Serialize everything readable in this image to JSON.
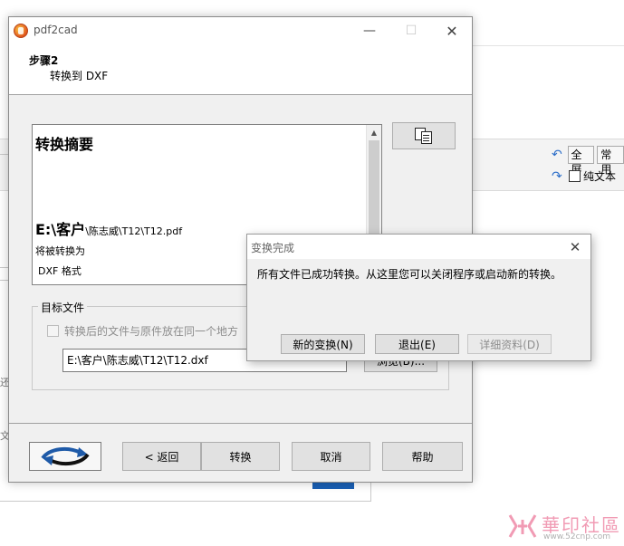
{
  "background": {
    "toolbar": {
      "fullscreen_label": "全屏",
      "common_label": "常用",
      "plain_text_label": "纯文本"
    },
    "left_fragments": [
      "还",
      "文用"
    ]
  },
  "wizard": {
    "title": "pdf2cad",
    "step": {
      "title": "步骤2",
      "subtitle": "转换到 DXF"
    },
    "summary": {
      "heading": "转换摘要",
      "path_big": "E:\\客户",
      "path_small": "\\陈志威\\T12\\T12.pdf",
      "will_convert": "将被转换为",
      "format": "DXF 格式"
    },
    "target": {
      "legend": "目标文件",
      "same_dir_label": "转换后的文件与原件放在同一个地方",
      "path_value": "E:\\客户\\陈志威\\T12\\T12.dxf",
      "browse_label": "浏览(B)..."
    },
    "buttons": {
      "back": "< 返回",
      "convert": "转换",
      "cancel": "取消",
      "help": "帮助"
    }
  },
  "dialog": {
    "title": "变换完成",
    "message": "所有文件已成功转换。从这里您可以关闭程序或启动新的转换。",
    "buttons": {
      "new": "新的变换(N)",
      "exit": "退出(E)",
      "details": "详细资料(D)"
    }
  },
  "watermark": {
    "text": "華印社區",
    "url": "www.52cnp.com"
  }
}
